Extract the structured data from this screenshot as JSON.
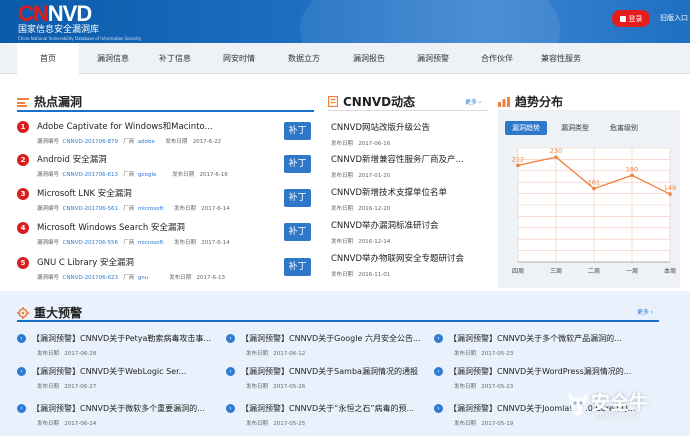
{
  "header": {
    "logo_c": "CN",
    "logo_rest": "NVD",
    "logo_cn": "国家信息安全漏洞库",
    "logo_en": "China National Vulnerability Database of Information Security",
    "login_label": "登录",
    "old_entry": "旧版入口"
  },
  "nav": {
    "items": [
      "首页",
      "漏洞信息",
      "补丁信息",
      "网安时情",
      "数据立方",
      "漏洞报告",
      "漏洞预警",
      "合作伙伴",
      "兼容性服务"
    ]
  },
  "hot": {
    "title": "热点漏洞",
    "items": [
      {
        "num": "1",
        "title": "Adobe Captivate for Windows和Macinto...",
        "id_label": "漏洞编号",
        "id": "CNNVD-201706-879",
        "vendor_label": "厂商",
        "vendor": "adobe",
        "date_label": "发布日期",
        "date": "2017-6-22",
        "btn": "补丁"
      },
      {
        "num": "2",
        "title": "Android 安全漏洞",
        "id_label": "漏洞编号",
        "id": "CNNVD-201706-613",
        "vendor_label": "厂商",
        "vendor": "google",
        "date_label": "发布日期",
        "date": "2017-6-16",
        "btn": "补丁"
      },
      {
        "num": "3",
        "title": "Microsoft LNK 安全漏洞",
        "id_label": "漏洞编号",
        "id": "CNNVD-201706-561",
        "vendor_label": "厂商",
        "vendor": "microsoft",
        "date_label": "发布日期",
        "date": "2017-6-14",
        "btn": "补丁"
      },
      {
        "num": "4",
        "title": "Microsoft Windows Search 安全漏洞",
        "id_label": "漏洞编号",
        "id": "CNNVD-201706-556",
        "vendor_label": "厂商",
        "vendor": "microsoft",
        "date_label": "发布日期",
        "date": "2017-6-14",
        "btn": "补丁"
      },
      {
        "num": "5",
        "title": "GNU C Library 安全漏洞",
        "id_label": "漏洞编号",
        "id": "CNNVD-201706-623",
        "vendor_label": "厂商",
        "vendor": "gnu",
        "date_label": "发布日期",
        "date": "2017-6-13",
        "btn": "补丁"
      }
    ]
  },
  "dynamic": {
    "title": "CNNVD动态",
    "more": "更多 ›",
    "items": [
      {
        "title": "CNNVD网站改版升级公告",
        "date_label": "发布日期",
        "date": "2017-06-16"
      },
      {
        "title": "CNNVD新增兼容性服务厂商及产...",
        "date_label": "发布日期",
        "date": "2017-01-20"
      },
      {
        "title": "CNNVD新增技术支撑单位名单",
        "date_label": "发布日期",
        "date": "2016-12-20"
      },
      {
        "title": "CNNVD举办漏洞标准研讨会",
        "date_label": "发布日期",
        "date": "2016-12-14"
      },
      {
        "title": "CNNVD举办物联网安全专题研讨会",
        "date_label": "发布日期",
        "date": "2016-11-01"
      }
    ]
  },
  "trend": {
    "title": "趋势分布",
    "tabs": [
      "漏洞趋势",
      "漏洞类型",
      "危害级别"
    ]
  },
  "chart_data": {
    "type": "line",
    "categories": [
      "四周",
      "三周",
      "二周",
      "一周",
      "本周"
    ],
    "values": [
      212,
      230,
      161,
      190,
      149
    ],
    "ylim": [
      0,
      250
    ],
    "grid": true,
    "color": "#f0803c"
  },
  "alerts": {
    "title": "重大预警",
    "more": "更多 ›",
    "items": [
      {
        "title": "【漏洞预警】CNNVD关于Petya勒索病毒攻击事...",
        "date_label": "发布日期",
        "date": "2017-06-28"
      },
      {
        "title": "【漏洞预警】CNNVD关于Google 六月安全公告...",
        "date_label": "发布日期",
        "date": "2017-06-12"
      },
      {
        "title": "【漏洞预警】CNNVD关于多个微软产品漏洞的...",
        "date_label": "发布日期",
        "date": "2017-05-23"
      },
      {
        "title": "【漏洞预警】CNNVD关于WebLogic Ser...",
        "date_label": "发布日期",
        "date": "2017-06-27"
      },
      {
        "title": "【漏洞预警】CNNVD关于Samba漏洞情况的通报",
        "date_label": "发布日期",
        "date": "2017-05-26"
      },
      {
        "title": "【漏洞预警】CNNVD关于WordPress漏洞情况的...",
        "date_label": "发布日期",
        "date": "2017-05-23"
      },
      {
        "title": "【漏洞预警】CNNVD关于微软多个重要漏洞的...",
        "date_label": "发布日期",
        "date": "2017-06-14"
      },
      {
        "title": "【漏洞预警】CNNVD关于“永恒之石”病毒的预...",
        "date_label": "发布日期",
        "date": "2017-05-25"
      },
      {
        "title": "【漏洞预警】CNNVD关于Joomla!3.7.0 Core SQ...",
        "date_label": "发布日期",
        "date": "2017-05-19"
      }
    ]
  },
  "watermark": {
    "text": "安全牛",
    "sub": "AQNIU.COM"
  },
  "colors": {
    "brand_blue": "#1a6fc8",
    "brand_red": "#e31a1a",
    "accent_orange": "#f0803c"
  }
}
